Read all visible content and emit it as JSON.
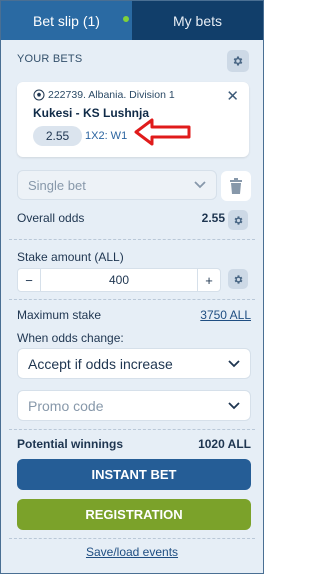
{
  "tabs": [
    {
      "label": "Bet slip (1)",
      "active": true
    },
    {
      "label": "My bets",
      "active": false
    }
  ],
  "your_bets": {
    "title": "YOUR BETS"
  },
  "bet": {
    "event_id_league": "222739. Albania. Division 1",
    "teams": "Kukesi - KS Lushnja",
    "odds": "2.55",
    "market": "1X2: W1",
    "sport_icon": "soccer-ball-icon"
  },
  "bet_type": {
    "selected": "Single bet"
  },
  "overall_odds": {
    "label": "Overall odds",
    "value": "2.55"
  },
  "stake": {
    "label": "Stake amount (ALL)",
    "value": "400",
    "minus": "−",
    "plus": "+"
  },
  "max_stake": {
    "label": "Maximum stake",
    "value": "3750 ALL"
  },
  "odds_change": {
    "label": "When odds change:",
    "selected": "Accept if odds increase"
  },
  "promo": {
    "placeholder": "Promo code"
  },
  "winnings": {
    "label": "Potential winnings",
    "value": "1020 ALL"
  },
  "buttons": {
    "instant": "INSTANT BET",
    "registration": "REGISTRATION"
  },
  "footer": {
    "save_load": "Save/load events"
  },
  "colors": {
    "header_active": "#2a6aa3",
    "header_inactive": "#113e6a",
    "instant_button": "#255d96",
    "registration_button": "#7ba22a",
    "annotation_arrow": "#e01b1b",
    "notification_dot": "#7fd13b"
  }
}
